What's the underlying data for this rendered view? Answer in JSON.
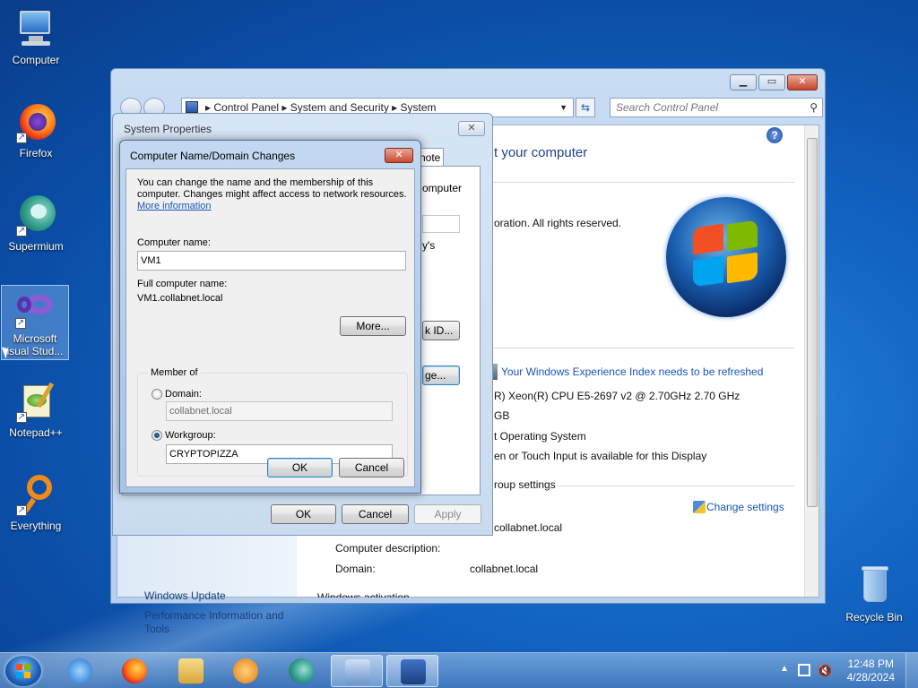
{
  "desktop": {
    "icons": [
      {
        "label": "Computer",
        "icon": "computer-icon"
      },
      {
        "label": "Firefox",
        "icon": "firefox-icon"
      },
      {
        "label": "Supermium",
        "icon": "supermium-icon"
      },
      {
        "label": "Microsoft Visual Stud...",
        "label_line1": "Microsoft",
        "label_line2": "isual Stud...",
        "icon": "visual-studio-icon"
      },
      {
        "label": "Notepad++",
        "icon": "notepadpp-icon"
      },
      {
        "label": "Everything",
        "icon": "everything-icon"
      },
      {
        "label": "Recycle Bin",
        "icon": "recycle-bin-icon"
      }
    ]
  },
  "control_panel": {
    "breadcrumb": [
      "Control Panel",
      "System and Security",
      "System"
    ],
    "search_placeholder": "Search Control Panel",
    "heading_partial": "t your computer",
    "copyright_partial": "oration.  All rights reserved.",
    "rating_link": "Your Windows Experience Index needs to be refreshed",
    "processor": "R) Xeon(R) CPU E5-2697 v2 @ 2.70GHz   2.70 GHz",
    "ram_partial": "GB",
    "system_type_partial": "t Operating System",
    "pen_touch_partial": "en or Touch Input is available for this Display",
    "group_settings_partial": "roup settings",
    "change_settings": "Change settings",
    "full_name_partial": "collabnet.local",
    "computer_description_label": "Computer description:",
    "domain_label": "Domain:",
    "domain_value": "collabnet.local",
    "activation_partial": "Windows activation",
    "left_links": [
      "Windows Update",
      "Performance Information and Tools"
    ]
  },
  "system_properties": {
    "title": "System Properties",
    "tab_partial": "note",
    "behind_text_1": "omputer",
    "behind_text_2": "y's",
    "behind_btn_1": "k ID...",
    "behind_btn_2": "ge...",
    "ok": "OK",
    "cancel": "Cancel",
    "apply": "Apply"
  },
  "name_dialog": {
    "title": "Computer Name/Domain Changes",
    "desc_line1": "You can change the name and the membership of this",
    "desc_line2": "computer. Changes might affect access to network resources.",
    "more_info": "More information",
    "computer_name_label": "Computer name:",
    "computer_name_value": "VM1",
    "full_name_label": "Full computer name:",
    "full_name_value": "VM1.collabnet.local",
    "more_button": "More...",
    "member_of": "Member of",
    "domain_label": "Domain:",
    "domain_value": "collabnet.local",
    "workgroup_label": "Workgroup:",
    "workgroup_value": "CRYPTOPIZZA",
    "selected": "workgroup",
    "ok": "OK",
    "cancel": "Cancel"
  },
  "taskbar": {
    "apps": [
      "internet-explorer-icon",
      "firefox-icon",
      "explorer-icon",
      "media-player-icon",
      "supermium-icon",
      "control-panel-icon",
      "system-properties-icon"
    ],
    "time": "12:48 PM",
    "date": "4/28/2024"
  }
}
